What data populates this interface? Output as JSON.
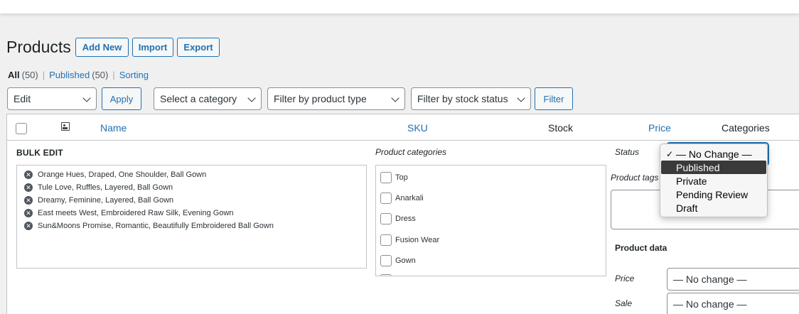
{
  "page": {
    "title": "Products",
    "buttons": {
      "add_new": "Add New",
      "import": "Import",
      "export": "Export"
    }
  },
  "views": {
    "all_label": "All",
    "all_count": "(50)",
    "published_label": "Published",
    "published_count": "(50)",
    "sorting_label": "Sorting",
    "separator": "|"
  },
  "filters": {
    "bulk_action": "Edit",
    "apply": "Apply",
    "category": "Select a category",
    "product_type": "Filter by product type",
    "stock_status": "Filter by stock status",
    "filter": "Filter"
  },
  "table": {
    "columns": {
      "name": "Name",
      "sku": "SKU",
      "stock": "Stock",
      "price": "Price",
      "categories": "Categories"
    }
  },
  "bulk_edit": {
    "title": "BULK EDIT",
    "remove_glyph": "✕",
    "items": [
      "Orange Hues, Draped, One Shoulder, Ball Gown",
      "Tule Love, Ruffles, Layered, Ball Gown",
      "Dreamy, Feminine, Layered, Ball Gown",
      "East meets West, Embroidered Raw Silk, Evening Gown",
      "Sun&Moons Promise, Romantic, Beautifully Embroidered Ball Gown"
    ],
    "categories_label": "Product categories",
    "categories": [
      "Top",
      "Anarkali",
      "Dress",
      "Fusion Wear",
      "Gown"
    ],
    "status_label": "Status",
    "status_options": [
      "— No Change —",
      "Published",
      "Private",
      "Pending Review",
      "Draft"
    ],
    "status_checked": "✓",
    "tags_label": "Product tags",
    "product_data_label": "Product data",
    "price_label": "Price",
    "price_value": "— No change —",
    "sale_label": "Sale",
    "sale_value": "— No change —"
  },
  "colors": {
    "link": "#2271b1",
    "text": "#1d2327",
    "background": "#f0f0f1"
  },
  "icons": {
    "image_column": "image-icon",
    "remove": "remove-circle-icon",
    "dropdown": "chevron-down-icon"
  }
}
